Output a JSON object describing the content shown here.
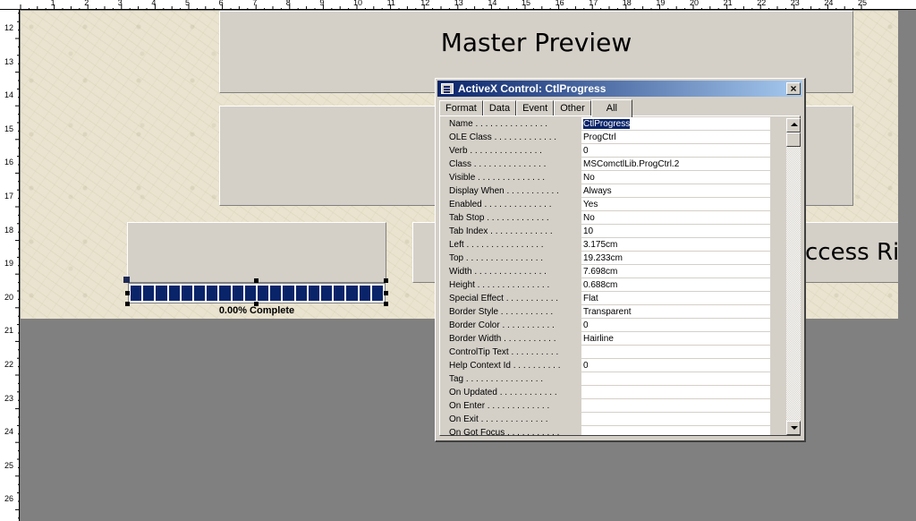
{
  "ruler_top_numbers": [
    "1",
    "2",
    "3",
    "4",
    "5",
    "6",
    "7",
    "8",
    "9",
    "10",
    "11",
    "12",
    "13",
    "14",
    "15",
    "16",
    "17",
    "18",
    "19",
    "20",
    "21",
    "22",
    "23",
    "24",
    "25"
  ],
  "ruler_left_numbers": [
    "12",
    "13",
    "14",
    "15",
    "16",
    "17",
    "18",
    "19",
    "20",
    "21",
    "22",
    "23",
    "24",
    "25",
    "26"
  ],
  "form": {
    "master_preview_title": "Master Preview",
    "access_text": "ccess Ri",
    "progress_label": "0.00% Complete",
    "progress_percent": 0.0,
    "progress_segments": 20
  },
  "property_window": {
    "title": "ActiveX Control: CtlProgress",
    "close_label": "×",
    "tabs": [
      "Format",
      "Data",
      "Event",
      "Other",
      "All"
    ],
    "active_tab": "All",
    "properties": [
      {
        "name": "Name . . . . . . . . . . . . . . .",
        "value": "CtlProgress",
        "selected": true
      },
      {
        "name": "OLE Class . . . . . . . . . . . . .",
        "value": "ProgCtrl"
      },
      {
        "name": "Verb . . . . . . . . . . . . . . .",
        "value": "0"
      },
      {
        "name": "Class . . . . . . . . . . . . . . .",
        "value": "MSComctlLib.ProgCtrl.2"
      },
      {
        "name": "Visible . . . . . . . . . . . . . .",
        "value": "No"
      },
      {
        "name": "Display When . . . . . . . . . . .",
        "value": "Always"
      },
      {
        "name": "Enabled . . . . . . . . . . . . . .",
        "value": "Yes"
      },
      {
        "name": "Tab Stop . . . . . . . . . . . . .",
        "value": "No"
      },
      {
        "name": "Tab Index . . . . . . . . . . . . .",
        "value": "10"
      },
      {
        "name": "Left . . . . . . . . . . . . . . . .",
        "value": "3.175cm"
      },
      {
        "name": "Top . . . . . . . . . . . . . . . .",
        "value": "19.233cm"
      },
      {
        "name": "Width . . . . . . . . . . . . . . .",
        "value": "7.698cm"
      },
      {
        "name": "Height . . . . . . . . . . . . . . .",
        "value": "0.688cm"
      },
      {
        "name": "Special Effect . . . . . . . . . . .",
        "value": "Flat"
      },
      {
        "name": "Border Style . . . . . . . . . . .",
        "value": "Transparent"
      },
      {
        "name": "Border Color . . . . . . . . . . .",
        "value": "0"
      },
      {
        "name": "Border Width . . . . . . . . . . .",
        "value": "Hairline"
      },
      {
        "name": "ControlTip Text . . . . . . . . . .",
        "value": ""
      },
      {
        "name": "Help Context Id . . . . . . . . . .",
        "value": "0"
      },
      {
        "name": "Tag . . . . . . . . . . . . . . . .",
        "value": ""
      },
      {
        "name": "On Updated . . . . . . . . . . . .",
        "value": ""
      },
      {
        "name": "On Enter . . . . . . . . . . . . .",
        "value": ""
      },
      {
        "name": "On Exit . . . . . . . . . . . . . .",
        "value": ""
      },
      {
        "name": "On Got Focus . . . . . . . . . . .",
        "value": ""
      }
    ]
  },
  "colors": {
    "titlebar_start": "#0a246a",
    "titlebar_end": "#a6caf0",
    "progress_fill": "#0a246a",
    "form_background": "#e9e3cf",
    "workspace_gray": "#808080"
  }
}
